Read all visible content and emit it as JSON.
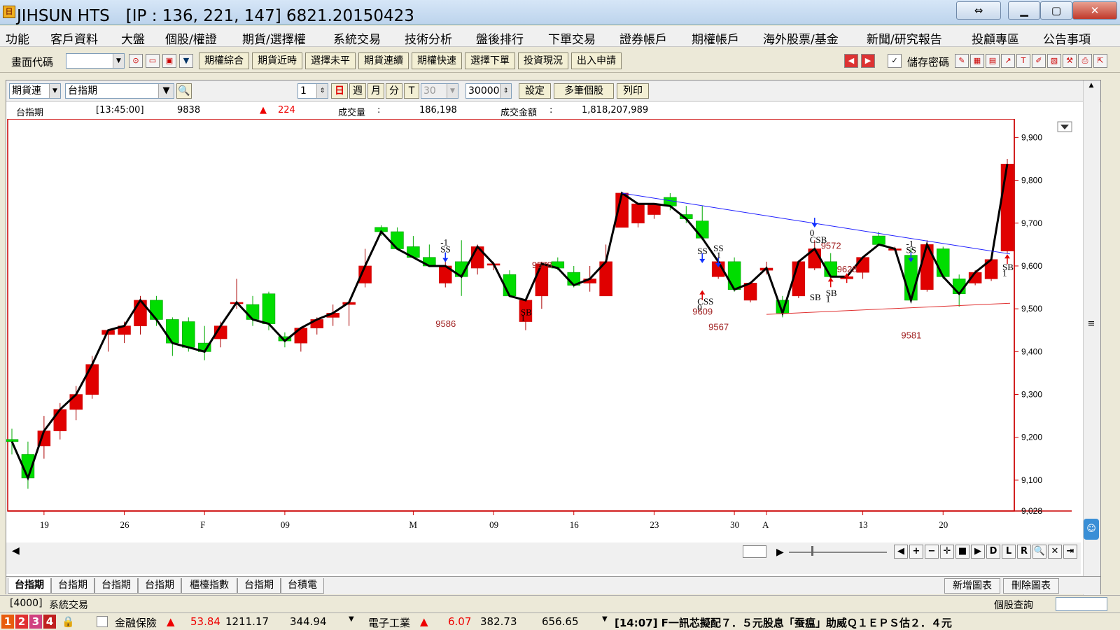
{
  "window": {
    "title": "JIHSUN HTS　[IP : 136, 221, 147] 6821.20150423",
    "icon": "app-logo-icon"
  },
  "menu": [
    "功能",
    "客戶資料",
    "大盤",
    "個股/權證",
    "期貨/選擇權",
    "系統交易",
    "技術分析",
    "盤後排行",
    "下單交易",
    "證券帳戶",
    "期權帳戶",
    "海外股票/基金",
    "新聞/研究報告",
    "投顧專區",
    "公告事項"
  ],
  "toolbar": {
    "code_label": "畫面代碼",
    "buttons": [
      "期權綜合",
      "期貨近時",
      "選擇未平",
      "期貨連續",
      "期權快速",
      "選擇下單",
      "投資現況",
      "出入申請"
    ],
    "save_password_label": "儲存密碼"
  },
  "controls": {
    "type_select": "期貨連",
    "symbol": "台指期",
    "period_value": "1",
    "periods": [
      "日",
      "週",
      "月",
      "分",
      "T"
    ],
    "minute_value": "30",
    "count_value": "30000",
    "settings": "設定",
    "multi": "多筆個股",
    "print": "列印"
  },
  "info": {
    "name": "台指期",
    "time": "[13:45:00]",
    "price": "9838",
    "change_arrow": "▲",
    "change": "224",
    "volume_label": "成交量",
    "volume_sep": ":",
    "volume": "186,198",
    "amount_label": "成交金額",
    "amount_sep": ":",
    "amount": "1,818,207,989"
  },
  "chart_data": {
    "type": "candlestick",
    "ylim": [
      9028,
      9930
    ],
    "y_ticks": [
      "9,900",
      "9,800",
      "9,700",
      "9,600",
      "9,500",
      "9,400",
      "9,300",
      "9,200",
      "9,100",
      "9,028"
    ],
    "x_ticks": [
      "19",
      "26",
      "F",
      "09",
      "M",
      "09",
      "16",
      "23",
      "30",
      "A",
      "13",
      "20"
    ],
    "up_color": "#e00000",
    "down_color": "#00dd00",
    "line_color": "#000000",
    "ohlc": [
      [
        9195,
        9220,
        9160,
        9190
      ],
      [
        9160,
        9190,
        9080,
        9105
      ],
      [
        9180,
        9250,
        9150,
        9215
      ],
      [
        9215,
        9280,
        9195,
        9265
      ],
      [
        9265,
        9320,
        9240,
        9300
      ],
      [
        9300,
        9390,
        9290,
        9370
      ],
      [
        9440,
        9450,
        9400,
        9450
      ],
      [
        9440,
        9470,
        9420,
        9460
      ],
      [
        9460,
        9530,
        9440,
        9520
      ],
      [
        9520,
        9530,
        9460,
        9475
      ],
      [
        9475,
        9480,
        9390,
        9420
      ],
      [
        9470,
        9480,
        9400,
        9410
      ],
      [
        9420,
        9460,
        9380,
        9400
      ],
      [
        9430,
        9470,
        9410,
        9460
      ],
      [
        9515,
        9570,
        9500,
        9515
      ],
      [
        9510,
        9530,
        9460,
        9475
      ],
      [
        9535,
        9540,
        9450,
        9465
      ],
      [
        9435,
        9445,
        9410,
        9425
      ],
      [
        9420,
        9455,
        9400,
        9455
      ],
      [
        9455,
        9480,
        9440,
        9475
      ],
      [
        9480,
        9510,
        9460,
        9490
      ],
      [
        9510,
        9520,
        9460,
        9515
      ],
      [
        9560,
        9640,
        9550,
        9600
      ],
      [
        9690,
        9695,
        9670,
        9680
      ],
      [
        9680,
        9690,
        9640,
        9640
      ],
      [
        9645,
        9670,
        9620,
        9620
      ],
      [
        9620,
        9650,
        9600,
        9600
      ],
      [
        9560,
        9630,
        9550,
        9600
      ],
      [
        9610,
        9660,
        9530,
        9575
      ],
      [
        9595,
        9650,
        9580,
        9645
      ],
      [
        9605,
        9610,
        9590,
        9605
      ],
      [
        9580,
        9590,
        9530,
        9530
      ],
      [
        9470,
        9520,
        9450,
        9520
      ],
      [
        9530,
        9610,
        9500,
        9605
      ],
      [
        9610,
        9620,
        9590,
        9595
      ],
      [
        9585,
        9600,
        9550,
        9555
      ],
      [
        9560,
        9600,
        9540,
        9570
      ],
      [
        9530,
        9650,
        9530,
        9610
      ],
      [
        9690,
        9770,
        9690,
        9770
      ],
      [
        9700,
        9730,
        9690,
        9745
      ],
      [
        9720,
        9730,
        9710,
        9745
      ],
      [
        9760,
        9770,
        9730,
        9740
      ],
      [
        9720,
        9740,
        9700,
        9710
      ],
      [
        9705,
        9740,
        9660,
        9665
      ],
      [
        9575,
        9620,
        9570,
        9610
      ],
      [
        9610,
        9620,
        9540,
        9545
      ],
      [
        9520,
        9560,
        9515,
        9560
      ],
      [
        9590,
        9610,
        9580,
        9595
      ],
      [
        9520,
        9530,
        9480,
        9490
      ],
      [
        9530,
        9610,
        9525,
        9610
      ],
      [
        9595,
        9660,
        9590,
        9640
      ],
      [
        9610,
        9630,
        9570,
        9575
      ],
      [
        9570,
        9580,
        9570,
        9575
      ],
      [
        9585,
        9620,
        9570,
        9620
      ],
      [
        9670,
        9680,
        9650,
        9650
      ],
      [
        9640,
        9645,
        9635,
        9640
      ],
      [
        9625,
        9640,
        9515,
        9520
      ],
      [
        9545,
        9660,
        9540,
        9650
      ],
      [
        9640,
        9645,
        9570,
        9575
      ],
      [
        9570,
        9580,
        9505,
        9535
      ],
      [
        9560,
        9590,
        9555,
        9585
      ],
      [
        9570,
        9620,
        9565,
        9615
      ],
      [
        9635,
        9850,
        9630,
        9838
      ]
    ],
    "annotations": {
      "price_labels": [
        "9586",
        "9578",
        "9609",
        "9567",
        "9572",
        "9628",
        "9581"
      ],
      "signals": [
        "SS",
        "-1",
        "SB",
        "1",
        "CSS",
        "0",
        "CSB",
        "0",
        "SS",
        "-1",
        "SS",
        "SB",
        "SB",
        "1",
        "SS",
        "-1",
        "SB",
        "1"
      ]
    }
  },
  "nav_buttons": [
    "◀",
    "▶",
    "+",
    "−",
    "✛",
    "■",
    "▶",
    "D",
    "L",
    "R",
    "🔍",
    "✕",
    "⇥"
  ],
  "tabs": [
    "台指期",
    "台指期",
    "台指期",
    "台指期",
    "櫃檯指數",
    "台指期",
    "台積電"
  ],
  "tab_actions": [
    "新增圖表",
    "刪除圖表"
  ],
  "status": {
    "code": "[4000]",
    "name": "系統交易",
    "query_label": "個股查詢"
  },
  "ticker": {
    "tabs": [
      "1",
      "2",
      "3",
      "4"
    ],
    "sector1_name": "金融保險",
    "sector1_arrow": "▲",
    "sector1_change": "53.84",
    "sector1_value": "1211.17",
    "sector1_volume": "344.94",
    "sector2_name": "電子工業",
    "sector2_arrow": "▲",
    "sector2_change": "6.07",
    "sector2_value": "382.73",
    "sector2_volume": "656.65",
    "news": "[14:07]  F一訊芯擬配７．５元股息「蚕瘟」助威Ｑ１ＥＰＳ估２．４元"
  }
}
